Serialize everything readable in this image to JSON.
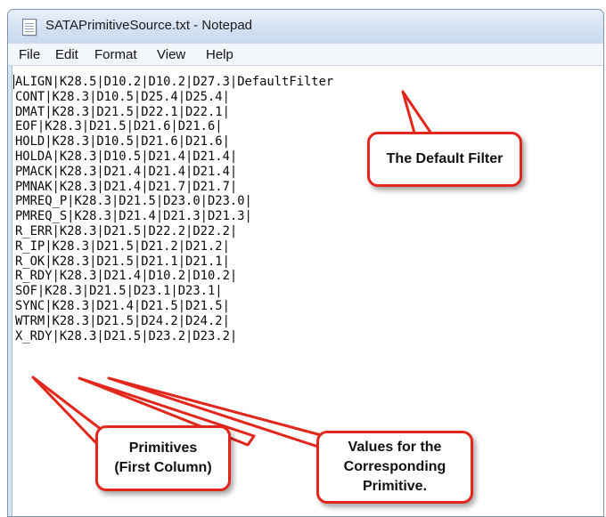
{
  "window": {
    "title": "SATAPrimitiveSource.txt - Notepad"
  },
  "menu": [
    {
      "label": "File"
    },
    {
      "label": "Edit"
    },
    {
      "label": "Format"
    },
    {
      "label": "View"
    },
    {
      "label": "Help"
    }
  ],
  "document": {
    "lines": [
      "ALIGN|K28.5|D10.2|D10.2|D27.3|DefaultFilter",
      "CONT|K28.3|D10.5|D25.4|D25.4|",
      "DMAT|K28.3|D21.5|D22.1|D22.1|",
      "EOF|K28.3|D21.5|D21.6|D21.6|",
      "HOLD|K28.3|D10.5|D21.6|D21.6|",
      "HOLDA|K28.3|D10.5|D21.4|D21.4|",
      "PMACK|K28.3|D21.4|D21.4|D21.4|",
      "PMNAK|K28.3|D21.4|D21.7|D21.7|",
      "PMREQ_P|K28.3|D21.5|D23.0|D23.0|",
      "PMREQ_S|K28.3|D21.4|D21.3|D21.3|",
      "R_ERR|K28.3|D21.5|D22.2|D22.2|",
      "R_IP|K28.3|D21.5|D21.2|D21.2|",
      "R_OK|K28.3|D21.5|D21.1|D21.1|",
      "R_RDY|K28.3|D21.4|D10.2|D10.2|",
      "SOF|K28.3|D21.5|D23.1|D23.1|",
      "SYNC|K28.3|D21.4|D21.5|D21.5|",
      "WTRM|K28.3|D21.5|D24.2|D24.2|",
      "X_RDY|K28.3|D21.5|D23.2|D23.2|"
    ]
  },
  "annotations": {
    "default_filter": "The Default Filter",
    "primitives_line1": "Primitives",
    "primitives_line2": "(First Column)",
    "values_line1": "Values for the",
    "values_line2": "Corresponding",
    "values_line3": "Primitive."
  },
  "colors": {
    "callout_border": "#e3261c",
    "titlebar": "#d2e0f2"
  }
}
